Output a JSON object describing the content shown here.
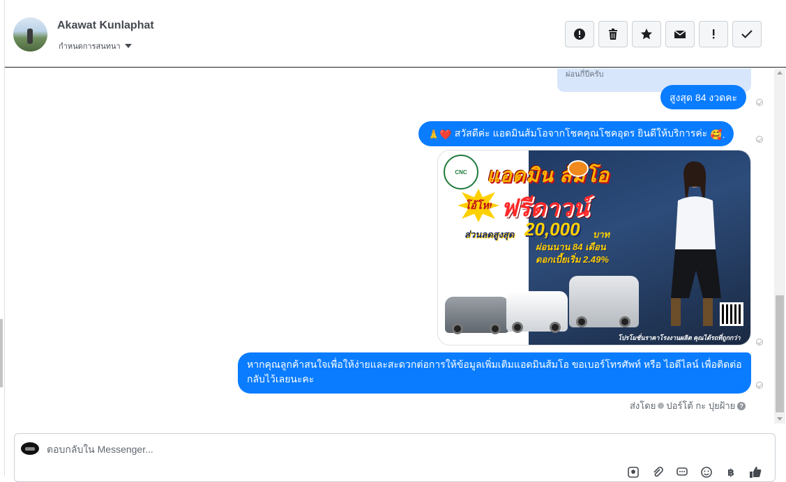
{
  "header": {
    "contact_name": "Akawat Kunlaphat",
    "conversation_settings": "กำหนดการสนทนา",
    "toolbar": [
      "report-icon",
      "trash-icon",
      "star-icon",
      "envelope-icon",
      "exclamation-icon",
      "check-icon"
    ]
  },
  "thread": {
    "quoted_text": "ผ่อนกี่ปีครับ",
    "msg1": "สูงสุด 84 งวดคะ",
    "msg2": {
      "emoji_prefix": "🙏❤️",
      "text": " สวัสดีค่ะ แอดมินส้มโอจากโชคคุณโชคอุดร ยินดีให้บริการค่ะ ",
      "emoji_suffix": "🥰."
    },
    "promo_image": {
      "logo_text": "CNC",
      "title": "แอดมิน ส้มโอ",
      "badge": "โอ้โห!",
      "headline": "ฟรีดาวน์",
      "discount_label": "ส่วนลดสูงสุด",
      "discount_amount": "20,000",
      "currency": "บาท",
      "term": "ผ่อนนาน 84 เดือน",
      "rate": "ดอกเบี้ยเริ่ม 2.49%",
      "footer": "โปรโมชั่นราคาโรงงานผลิต คุณได้รถที่ถูกกว่า"
    },
    "msg3": "หากคุณลูกค้าสนใจเพื่อให้ง่ายและสะดวกต่อการให้ข้อมูลเพิ่มเติมแอดมินส้มโอ ขอเบอร์โทรศัพท์ หรือ ไอดีไลน์ เพื่อติดต่อกลับไว้เลยนะคะ",
    "sent_by_label": "ส่งโดย",
    "sent_by_name": "ปอร์โต้ กะ ปุยฝ้าย"
  },
  "composer": {
    "placeholder": "ตอบกลับใน Messenger...",
    "tools": [
      "sticker-icon",
      "attachment-icon",
      "saved-replies-icon",
      "emoji-icon",
      "baht-icon",
      "like-icon"
    ],
    "baht_symbol": "฿"
  },
  "colors": {
    "bubble": "#0a7cff",
    "quoted_bg": "#d8e6fb",
    "header_border": "#1c1e21"
  }
}
